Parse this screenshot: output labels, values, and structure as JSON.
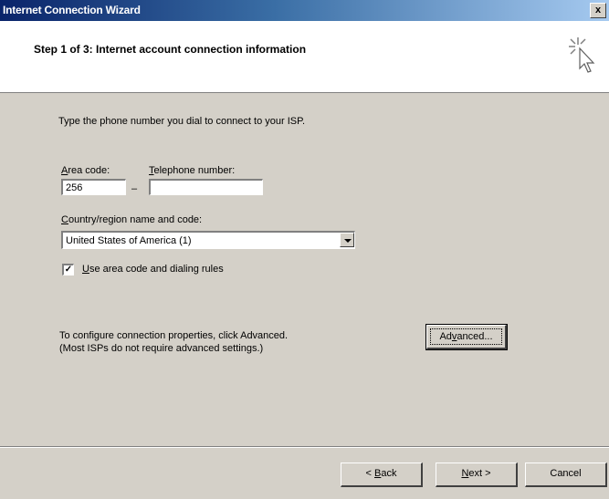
{
  "window": {
    "title": "Internet Connection Wizard",
    "close_label": "x"
  },
  "header": {
    "step_title": "Step 1 of 3: Internet account connection information",
    "icon": "wizard-cursor-icon"
  },
  "form": {
    "prompt": "Type the phone number you dial to connect to your ISP.",
    "area_code": {
      "label_accel": "A",
      "label_rest": "rea code:",
      "value": "256"
    },
    "separator": "–",
    "telephone": {
      "label_accel": "T",
      "label_rest": "elephone number:",
      "value": ""
    },
    "country": {
      "label_accel": "C",
      "label_rest": "ountry/region name and code:",
      "selected": "United States of America (1)"
    },
    "use_rules": {
      "checked": true,
      "label_accel": "U",
      "label_rest": "se area code and dialing rules"
    },
    "advanced_info": {
      "line1": "To configure connection properties, click Advanced.",
      "line2": "(Most ISPs do not require advanced settings.)"
    },
    "advanced_button": {
      "pre": "Ad",
      "accel": "v",
      "post": "anced..."
    }
  },
  "footer": {
    "back": {
      "pre": "< ",
      "accel": "B",
      "post": "ack"
    },
    "next": {
      "pre": "",
      "accel": "N",
      "post": "ext >"
    },
    "cancel": "Cancel"
  }
}
